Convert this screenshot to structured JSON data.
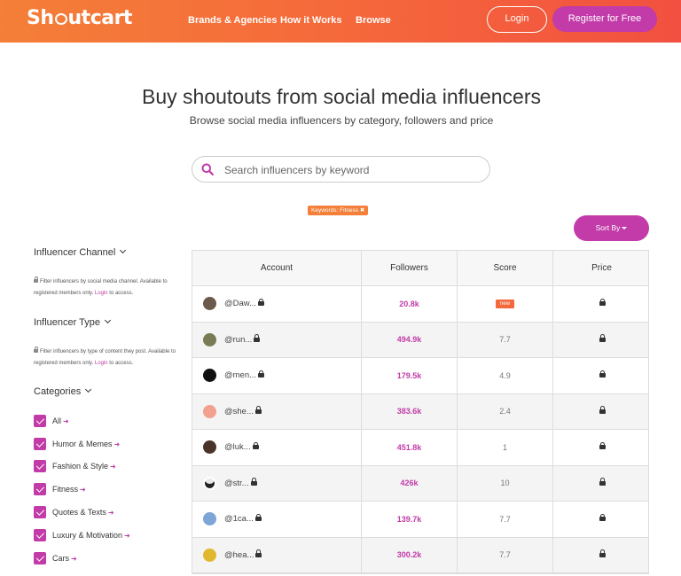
{
  "header": {
    "logo": "Shoutcart",
    "nav": [
      "Brands & Agencies",
      "How it Works",
      "Browse"
    ],
    "login_label": "Login",
    "register_label": "Register for Free"
  },
  "hero": {
    "title": "Buy shoutouts from social media influencers",
    "subtitle": "Browse social media influencers by category, followers and price"
  },
  "search": {
    "placeholder": "Search influencers by keyword",
    "value": ""
  },
  "filter_chip": "Keywords: Fitness ✖",
  "sort_label": "Sort By",
  "sidebar": {
    "channel": {
      "heading": "Influencer Channel",
      "note": "Filter influencers by social media channel. Available to registered members only.",
      "login": "Login",
      "suffix": "to access."
    },
    "type": {
      "heading": "Influencer Type",
      "note": "Filter influencers by type of content they post. Available to registered members only.",
      "login": "Login",
      "suffix": "to access."
    },
    "categories": {
      "heading": "Categories",
      "items": [
        "All",
        "Humor & Memes",
        "Fashion & Style",
        "Fitness",
        "Quotes & Texts",
        "Luxury & Motivation",
        "Cars"
      ]
    }
  },
  "table": {
    "headers": [
      "Account",
      "Followers",
      "Score",
      "Price"
    ],
    "rows": [
      {
        "account": "@Daw...",
        "followers": "20.8k",
        "score": "new"
      },
      {
        "account": "@run...",
        "followers": "494.9k",
        "score": "7.7"
      },
      {
        "account": "@men...",
        "followers": "179.5k",
        "score": "4.9"
      },
      {
        "account": "@she...",
        "followers": "383.6k",
        "score": "2.4"
      },
      {
        "account": "@luk...",
        "followers": "451.8k",
        "score": "1"
      },
      {
        "account": "@str...",
        "followers": "426k",
        "score": "10"
      },
      {
        "account": "@1ca...",
        "followers": "139.7k",
        "score": "7.7"
      },
      {
        "account": "@hea...",
        "followers": "300.2k",
        "score": "7.7"
      }
    ]
  },
  "colors": {
    "brand_orange": "#f47f38",
    "accent_magenta": "#c23ba8"
  }
}
